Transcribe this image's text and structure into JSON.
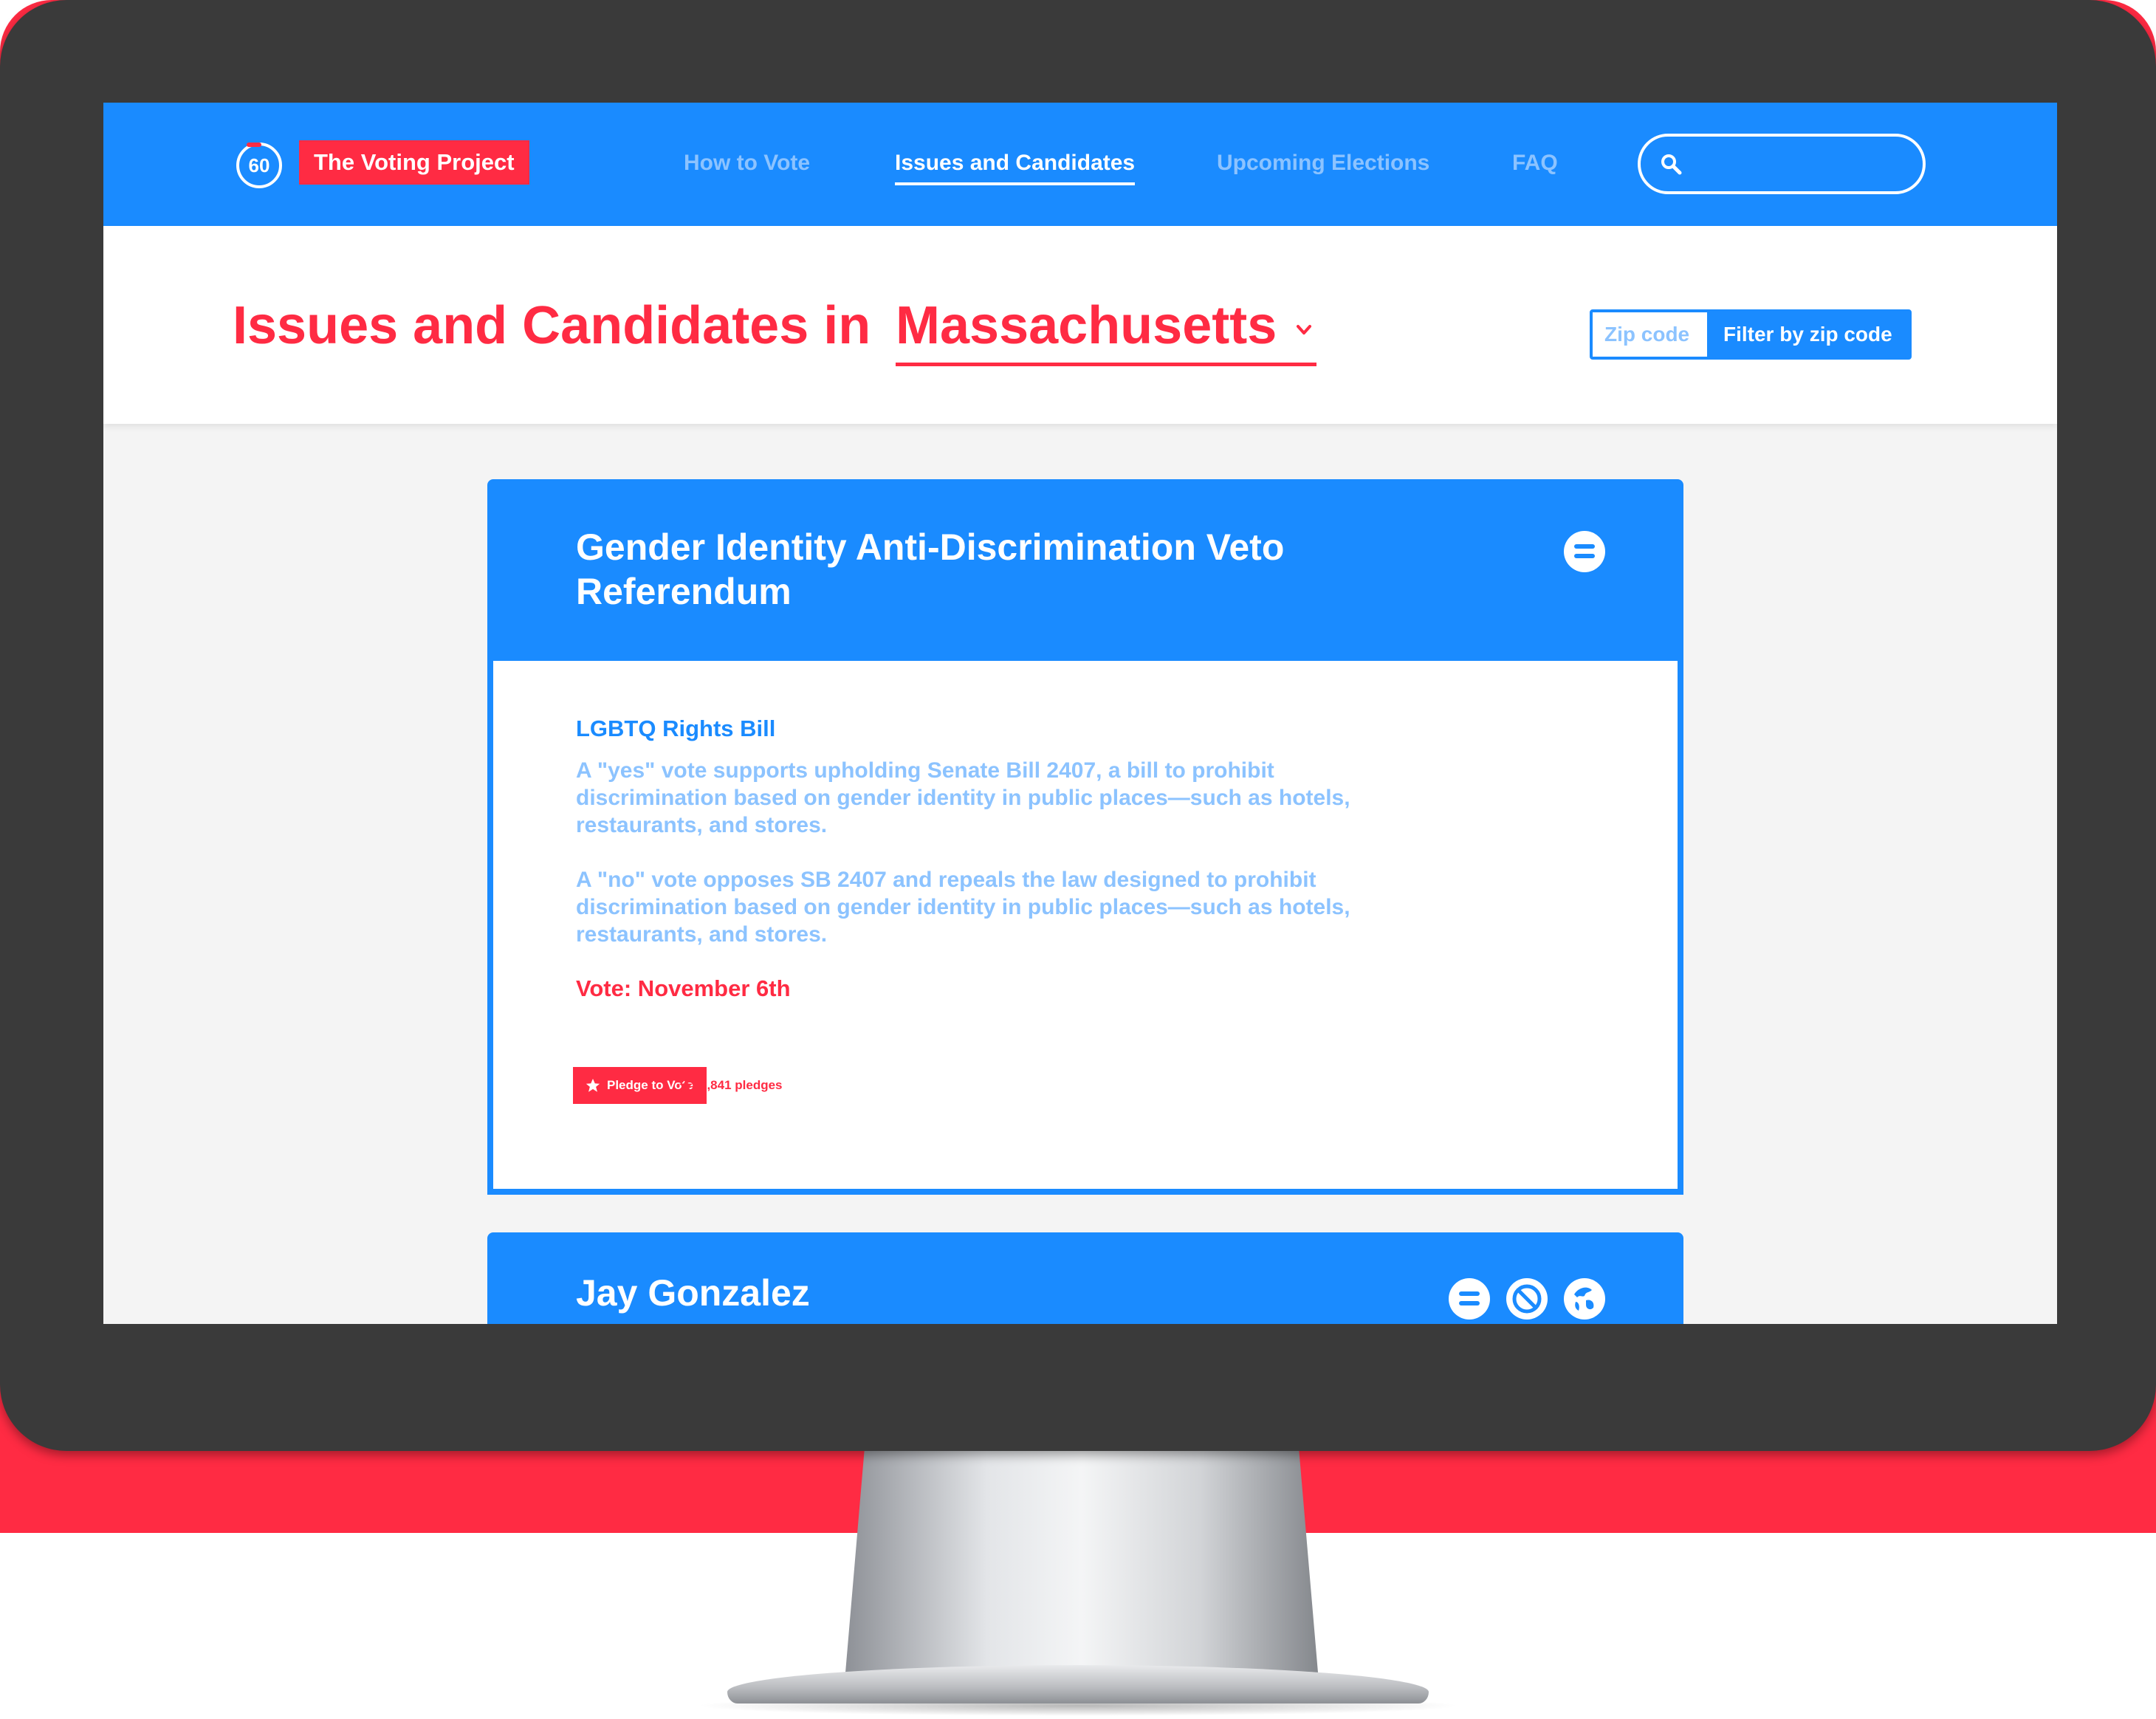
{
  "brand": {
    "logo_text": "60",
    "name": "The Voting Project"
  },
  "nav": {
    "links": [
      {
        "label": "How to Vote",
        "active": false
      },
      {
        "label": "Issues and Candidates",
        "active": true
      },
      {
        "label": "Upcoming Elections",
        "active": false
      },
      {
        "label": "FAQ",
        "active": false
      }
    ],
    "search_placeholder": ""
  },
  "header": {
    "title_prefix": "Issues and Candidates in",
    "state": "Massachusetts",
    "zip_placeholder": "Zip code",
    "filter_button": "Filter by zip code"
  },
  "cards": [
    {
      "title": "Gender Identity Anti-Discrimination Veto Referendum",
      "subtitle": "LGBTQ Rights Bill",
      "yes_text": "A \"yes\" vote supports upholding Senate Bill 2407, a bill to prohibit discrimination based on gender identity in public places—such as hotels, restaurants, and stores.",
      "no_text": "A \"no\" vote opposes SB 2407 and repeals the law designed to prohibit discrimination based on gender identity in public places—such as hotels, restaurants, and stores.",
      "vote_date": "Vote: November 6th",
      "pledge_button": "Pledge to Vote",
      "pledge_count": "2,841 pledges"
    },
    {
      "title": "Jay Gonzalez"
    }
  ],
  "icons": [
    "search-icon",
    "chevron-down-icon",
    "collapse-icon",
    "star-icon",
    "no-social-icon",
    "globe-icon"
  ],
  "colors": {
    "brand_blue": "#1a8bff",
    "brand_red": "#ff2b43",
    "muted_blue": "#8cc3ff",
    "bezel": "#3a3a3a"
  }
}
